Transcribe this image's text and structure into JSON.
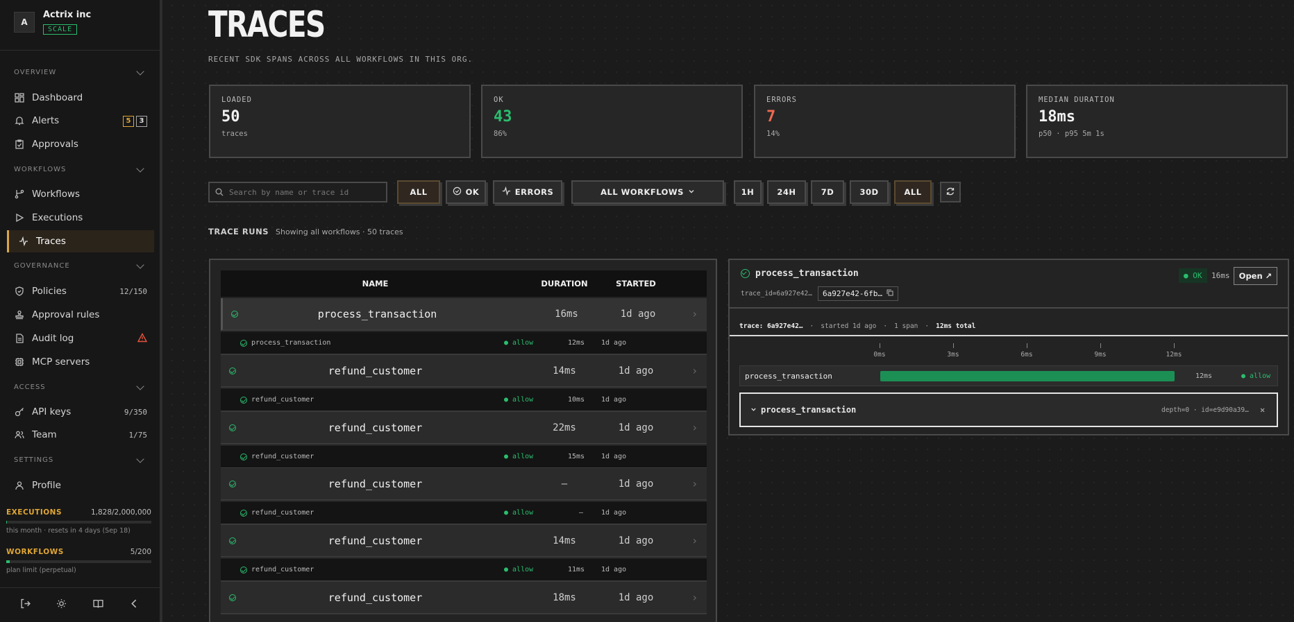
{
  "org": {
    "avatar": "A",
    "name": "Actrix inc",
    "plan": "SCALE"
  },
  "sidebar": {
    "sections": {
      "overview": "OVERVIEW",
      "workflows": "WORKFLOWS",
      "governance": "GOVERNANCE",
      "access": "ACCESS",
      "settings": "SETTINGS"
    },
    "items": {
      "dashboard": "Dashboard",
      "alerts": "Alerts",
      "alerts_badge_warn": "5",
      "alerts_badge_info": "3",
      "approvals": "Approvals",
      "workflows": "Workflows",
      "executions": "Executions",
      "traces": "Traces",
      "policies": "Policies",
      "policies_count": "12/150",
      "approval_rules": "Approval rules",
      "audit_log": "Audit log",
      "mcp_servers": "MCP servers",
      "api_keys": "API keys",
      "api_keys_count": "9/350",
      "team": "Team",
      "team_count": "1/75",
      "profile": "Profile"
    },
    "usage": {
      "executions_label": "EXECUTIONS",
      "executions_value": "1,828/2,000,000",
      "executions_note": "this month · resets in 4 days (Sep 18)",
      "executions_fraction": 0.0009,
      "workflows_label": "WORKFLOWS",
      "workflows_value": "5/200",
      "workflows_note": "plan limit (perpetual)",
      "workflows_fraction": 0.025
    }
  },
  "page": {
    "title": "TRACES",
    "subtitle": "RECENT SDK SPANS ACROSS ALL WORKFLOWS IN THIS ORG."
  },
  "stats": [
    {
      "label": "LOADED",
      "value": "50",
      "note": "traces",
      "color": "#f2f2f2"
    },
    {
      "label": "OK",
      "value": "43",
      "note": "86%",
      "color": "#2bbd6e"
    },
    {
      "label": "ERRORS",
      "value": "7",
      "note": "14%",
      "color": "#f06a4f"
    },
    {
      "label": "MEDIAN DURATION",
      "value": "18ms",
      "note": "p50 · p95 5m 1s",
      "color": "#f2f2f2"
    }
  ],
  "filters": {
    "search_placeholder": "Search by name or trace id",
    "status_all": "ALL",
    "status_ok": "OK",
    "status_errors": "ERRORS",
    "workflow_select": "ALL WORKFLOWS",
    "range_1h": "1H",
    "range_24h": "24H",
    "range_7d": "7D",
    "range_30d": "30D",
    "range_all": "ALL"
  },
  "runs": {
    "title": "TRACE RUNS",
    "subtitle": "Showing all workflows · 50 traces",
    "columns": {
      "name": "NAME",
      "duration": "DURATION",
      "started": "STARTED"
    },
    "rows": [
      {
        "name": "process_transaction",
        "duration": "16ms",
        "started": "1d ago",
        "span_name": "process_transaction",
        "decision": "● allow",
        "span_duration": "12ms",
        "span_started": "1d ago"
      },
      {
        "name": "refund_customer",
        "duration": "14ms",
        "started": "1d ago",
        "span_name": "refund_customer",
        "decision": "● allow",
        "span_duration": "10ms",
        "span_started": "1d ago"
      },
      {
        "name": "refund_customer",
        "duration": "22ms",
        "started": "1d ago",
        "span_name": "refund_customer",
        "decision": "● allow",
        "span_duration": "15ms",
        "span_started": "1d ago"
      },
      {
        "name": "refund_customer",
        "duration": "—",
        "started": "1d ago",
        "span_name": "refund_customer",
        "decision": "● allow",
        "span_duration": "—",
        "span_started": "1d ago"
      },
      {
        "name": "refund_customer",
        "duration": "14ms",
        "started": "1d ago",
        "span_name": "refund_customer",
        "decision": "● allow",
        "span_duration": "11ms",
        "span_started": "1d ago"
      },
      {
        "name": "refund_customer",
        "duration": "18ms",
        "started": "1d ago"
      }
    ]
  },
  "detail": {
    "name": "process_transaction",
    "trace_id_label": "trace_id=6a927e42…",
    "trace_id_short": "6a927e42-6fb…",
    "status": "● OK",
    "duration": "16ms",
    "open_label": "Open ↗",
    "meta_trace": "trace: 6a927e42…",
    "meta_started": "started 1d ago",
    "meta_spans": "1 span",
    "meta_total": "12ms total",
    "ticks": [
      "0ms",
      "3ms",
      "6ms",
      "9ms",
      "12ms"
    ],
    "span": {
      "name": "process_transaction",
      "duration": "12ms",
      "decision": "● allow",
      "start_fraction": 0.0,
      "duration_fraction": 1.0
    },
    "expanded": {
      "name": "process_transaction",
      "meta": "depth=0 · id=e9d90a39…"
    }
  },
  "colors": {
    "accent": "#d9a74a",
    "ok": "#2bbd6e",
    "error": "#f06a4f"
  }
}
